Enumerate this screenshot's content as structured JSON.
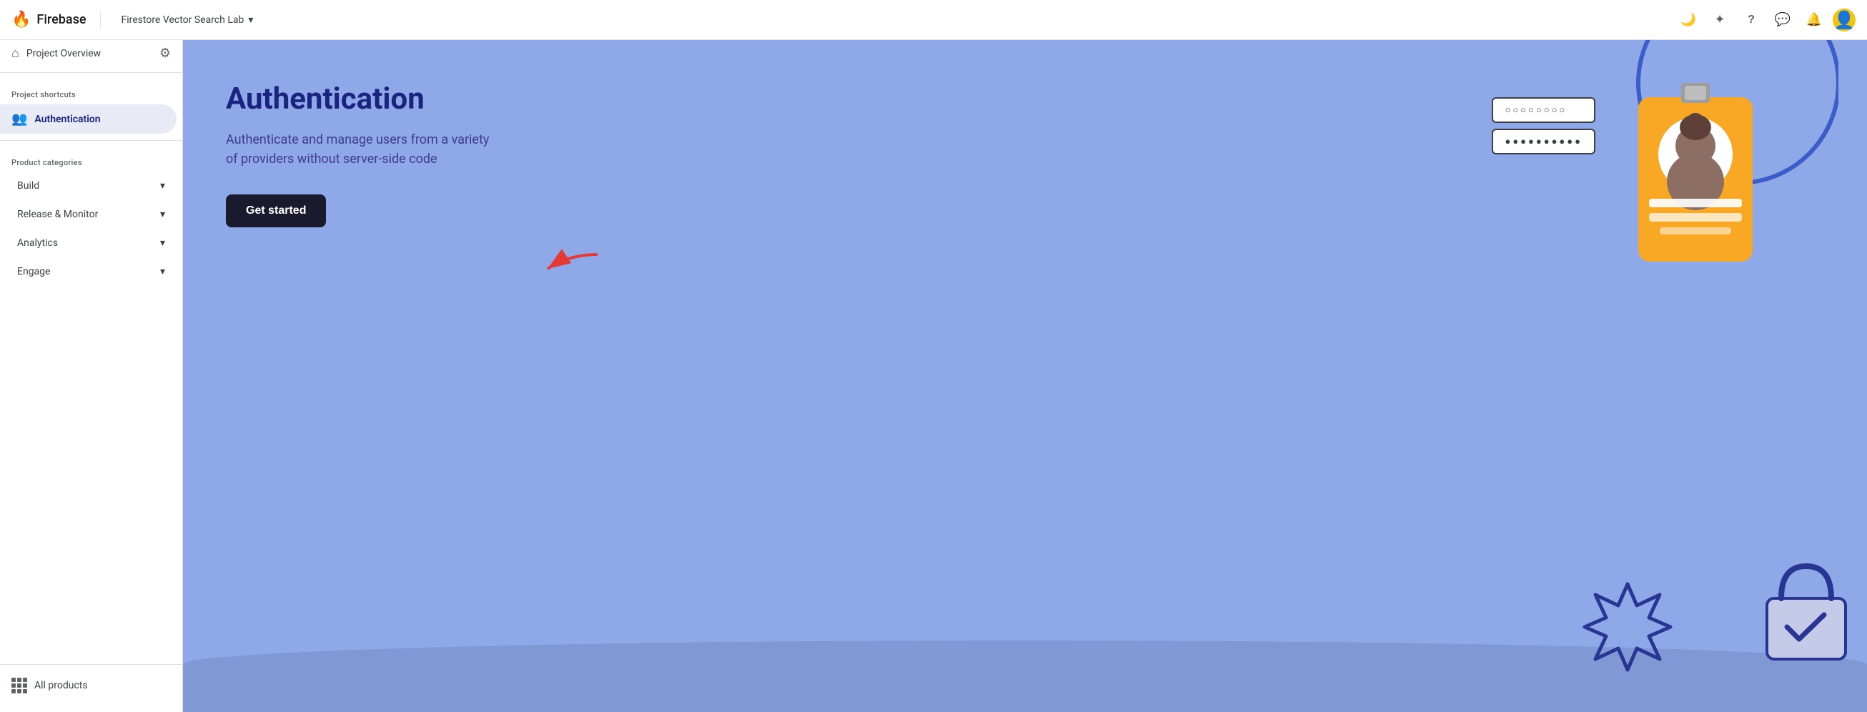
{
  "topNav": {
    "logoText": "Firebase",
    "projectName": "Firestore Vector Search Lab",
    "icons": {
      "moon": "🌙",
      "star": "✦",
      "help": "?",
      "chat": "💬",
      "bell": "🔔"
    }
  },
  "sidebar": {
    "homeLabel": "Project Overview",
    "sections": {
      "shortcuts": {
        "label": "Project shortcuts",
        "items": [
          {
            "id": "authentication",
            "label": "Authentication",
            "active": true
          }
        ]
      },
      "categories": {
        "label": "Product categories",
        "items": [
          {
            "id": "build",
            "label": "Build"
          },
          {
            "id": "release-monitor",
            "label": "Release & Monitor"
          },
          {
            "id": "analytics",
            "label": "Analytics"
          },
          {
            "id": "engage",
            "label": "Engage"
          }
        ]
      }
    },
    "allProductsLabel": "All products"
  },
  "hero": {
    "title": "Authentication",
    "description": "Authenticate and manage users from a variety of providers without server-side code",
    "ctaLabel": "Get started"
  },
  "illustration": {
    "passwordField1": "○○○○○○○○",
    "passwordField2": "●●●●●●●●●●"
  }
}
